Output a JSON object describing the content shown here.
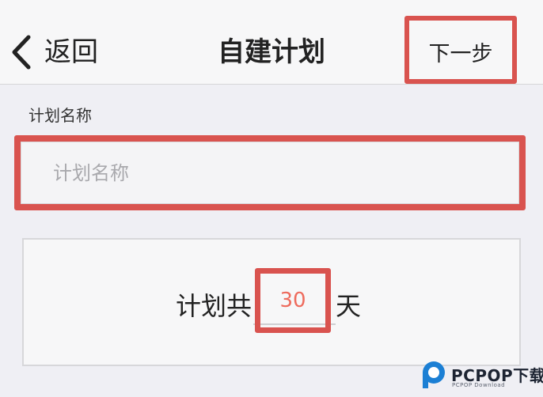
{
  "navbar": {
    "back_label": "返回",
    "title": "自建计划",
    "next_label": "下一步"
  },
  "plan_name": {
    "label": "计划名称",
    "value": "",
    "placeholder": "计划名称"
  },
  "duration": {
    "prefix": "计划共",
    "days": "30",
    "suffix": "天"
  },
  "colors": {
    "highlight": "#d9534f",
    "days_value": "#ee6b5d",
    "background": "#efeff4"
  },
  "watermark": {
    "brand": "PCPOP下载",
    "sub": "PCPOP Download"
  }
}
